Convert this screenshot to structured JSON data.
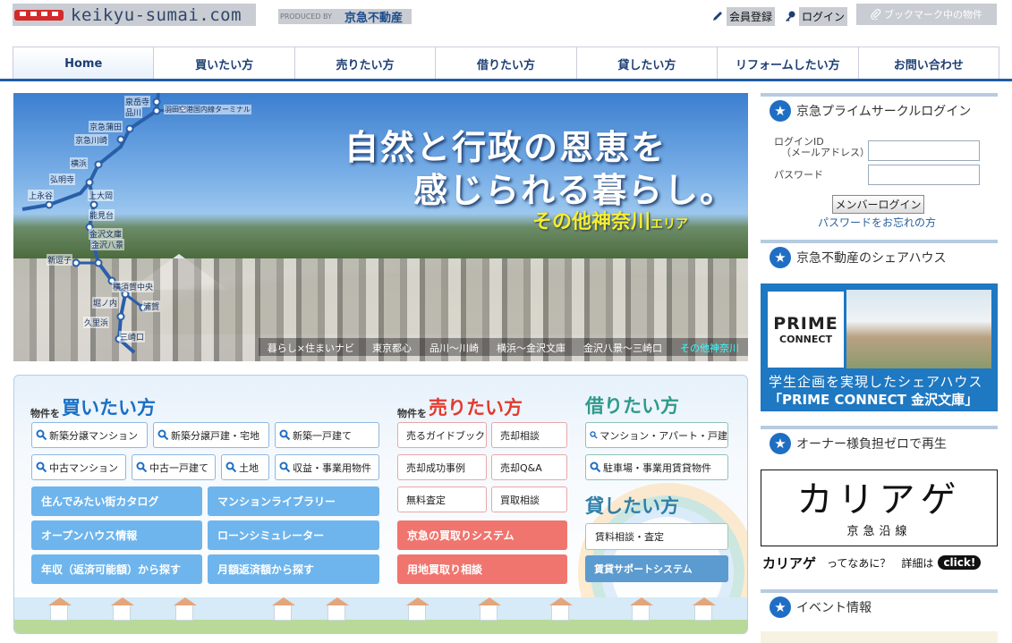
{
  "header": {
    "logo_text": "keikyu-sumai.com",
    "produced_by": "PRODUCED BY",
    "produced_company": "京急不動産",
    "member_register": "会員登録",
    "login": "ログイン",
    "bookmark": "ブックマーク中の物件"
  },
  "nav": {
    "items": [
      "Home",
      "買いたい方",
      "売りたい方",
      "借りたい方",
      "貸したい方",
      "リフォームしたい方",
      "お問い合わせ"
    ]
  },
  "hero": {
    "headline1": "自然と行政の恩恵を",
    "headline2": "感じられる暮らし。",
    "area_name": "その他神奈川",
    "area_suffix": "エリア",
    "stations": [
      "泉岳寺",
      "品川",
      "羽田空港国内線ターミナル",
      "京急蒲田",
      "京急川崎",
      "横浜",
      "弘明寺",
      "上永谷",
      "上大岡",
      "能見台",
      "金沢文庫",
      "金沢八景",
      "新逗子",
      "横須賀中央",
      "堀ノ内",
      "浦賀",
      "久里浜",
      "三崎口"
    ],
    "tabs": [
      "暮らし×住まいナビ",
      "東京都心",
      "品川～川崎",
      "横浜～金沢文庫",
      "金沢八景～三崎口",
      "その他神奈川"
    ],
    "active_tab": "その他神奈川"
  },
  "buy": {
    "prefix": "物件を",
    "title": "買いたい方",
    "search_buttons": [
      "新築分譲マンション",
      "新築分譲戸建・宅地",
      "新築一戸建て",
      "中古マンション",
      "中古一戸建て",
      "土地",
      "収益・事業用物件"
    ],
    "blue_buttons": [
      "住んでみたい街カタログ",
      "マンションライブラリー",
      "オープンハウス情報",
      "ローンシミュレーター",
      "年収（返済可能額）から探す",
      "月額返済額から探す"
    ]
  },
  "sell": {
    "prefix": "物件を",
    "title": "売りたい方",
    "buttons": [
      "売るガイドブック",
      "売却相談",
      "売却成功事例",
      "売却Q&A",
      "無料査定",
      "買取相談"
    ],
    "red_buttons": [
      "京急の買取りシステム",
      "用地買取り相談"
    ]
  },
  "rent": {
    "title": "借りたい方",
    "search_buttons": [
      "マンション・アパート・戸建",
      "駐車場・事業用賃貸物件"
    ]
  },
  "lend": {
    "title": "貸したい方",
    "button": "賃料相談・査定",
    "blue_button": "賃貸サポートシステム"
  },
  "sidebar": {
    "login_title": "京急プライムサークルログイン",
    "login_id_label": "ログインID\n（メールアドレス）",
    "login_id_l1": "ログインID",
    "login_id_l2": "（メールアドレス）",
    "password_label": "パスワード",
    "login_button": "メンバーログイン",
    "forgot": "パスワードをお忘れの方",
    "share_title": "京急不動産のシェアハウス",
    "share_logo1": "PRIME",
    "share_logo2": "CONNECT",
    "share_caption1": "学生企画を実現したシェアハウス",
    "share_caption2": "「PRIME CONNECT 金沢文庫」",
    "owner_title": "オーナー様負担ゼロで再生",
    "kariage_logo": "カリアゲ",
    "kariage_sub": "京急沿線",
    "kariage_info1": "カリアゲ",
    "kariage_info2": "ってなあに？",
    "kariage_info3": "詳細は",
    "kariage_click": "click!",
    "event_title": "イベント情報"
  },
  "colors": {
    "buy": "#1a6fc4",
    "sell": "#e23a2e",
    "rent": "#2f9a8c",
    "brand": "#1f5da6"
  }
}
